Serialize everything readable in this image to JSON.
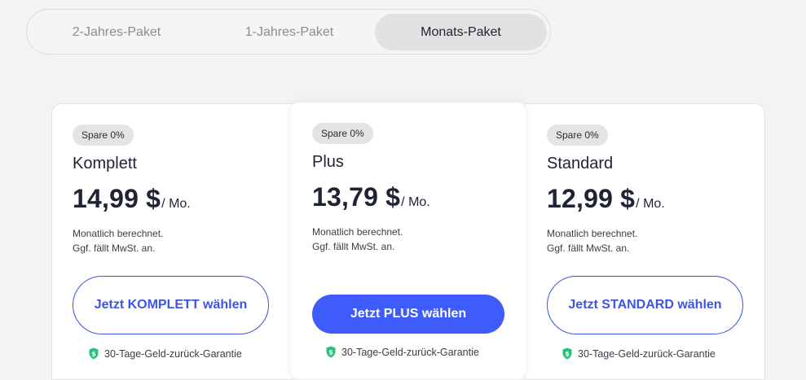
{
  "tabs": [
    {
      "label": "2-Jahres-Paket",
      "active": false
    },
    {
      "label": "1-Jahres-Paket",
      "active": false
    },
    {
      "label": "Monats-Paket",
      "active": true
    }
  ],
  "plans": [
    {
      "badge": "Spare 0%",
      "name": "Komplett",
      "price": "14,99 $",
      "unit": "/ Mo.",
      "note_line1": "Monatlich berechnet.",
      "note_line2": "Ggf. fällt MwSt. an.",
      "cta": "Jetzt KOMPLETT wählen",
      "cta_style": "outline",
      "guarantee": "30-Tage-Geld-zurück-Garantie"
    },
    {
      "badge": "Spare 0%",
      "name": "Plus",
      "price": "13,79 $",
      "unit": "/ Mo.",
      "note_line1": "Monatlich berechnet.",
      "note_line2": "Ggf. fällt MwSt. an.",
      "cta": "Jetzt PLUS wählen",
      "cta_style": "filled",
      "guarantee": "30-Tage-Geld-zurück-Garantie"
    },
    {
      "badge": "Spare 0%",
      "name": "Standard",
      "price": "12,99 $",
      "unit": "/ Mo.",
      "note_line1": "Monatlich berechnet.",
      "note_line2": "Ggf. fällt MwSt. an.",
      "cta": "Jetzt STANDARD wählen",
      "cta_style": "outline",
      "guarantee": "30-Tage-Geld-zurück-Garantie"
    }
  ],
  "icons": {
    "guarantee": "shield-dollar-icon"
  },
  "colors": {
    "accent": "#3e5bfc",
    "outline": "#3d55e0",
    "guarantee_icon": "#27c07d",
    "background": "#f3f3f3"
  }
}
